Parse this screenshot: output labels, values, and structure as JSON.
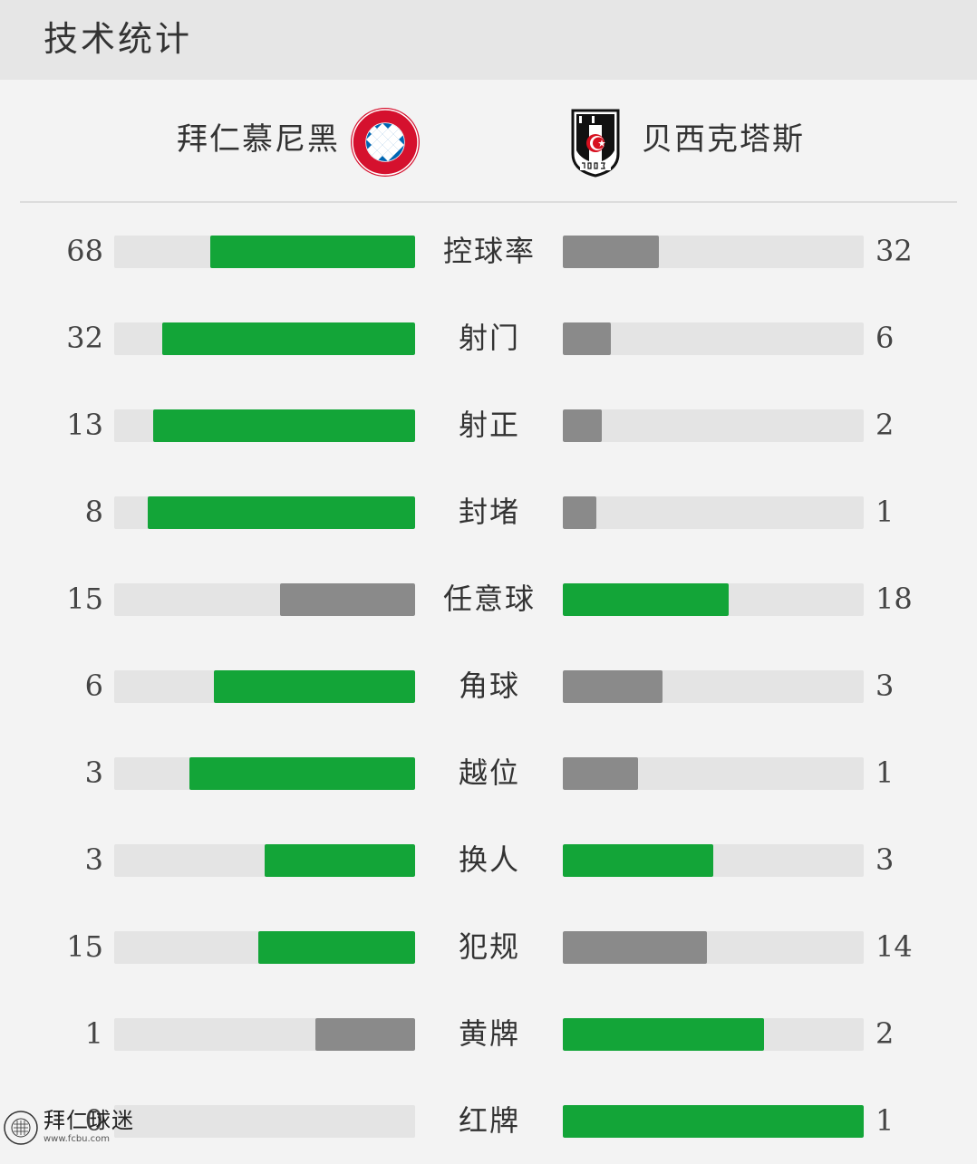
{
  "header": {
    "title": "技术统计"
  },
  "teams": {
    "home": {
      "name": "拜仁慕尼黑",
      "logo": "fc-bayern-logo-icon"
    },
    "away": {
      "name": "贝西克塔斯",
      "logo": "besiktas-logo-icon"
    }
  },
  "colors": {
    "leader": "#13a538",
    "trailer": "#8a8a8a",
    "track": "#e4e4e4"
  },
  "stats": [
    {
      "label": "控球率",
      "home": "68",
      "away": "32",
      "home_fill": 0.68,
      "away_fill": 0.32,
      "leader": "home"
    },
    {
      "label": "射门",
      "home": "32",
      "away": "6",
      "home_fill": 0.84,
      "away_fill": 0.16,
      "leader": "home"
    },
    {
      "label": "射正",
      "home": "13",
      "away": "2",
      "home_fill": 0.87,
      "away_fill": 0.13,
      "leader": "home"
    },
    {
      "label": "封堵",
      "home": "8",
      "away": "1",
      "home_fill": 0.89,
      "away_fill": 0.11,
      "leader": "home"
    },
    {
      "label": "任意球",
      "home": "15",
      "away": "18",
      "home_fill": 0.45,
      "away_fill": 0.55,
      "leader": "away"
    },
    {
      "label": "角球",
      "home": "6",
      "away": "3",
      "home_fill": 0.67,
      "away_fill": 0.33,
      "leader": "home"
    },
    {
      "label": "越位",
      "home": "3",
      "away": "1",
      "home_fill": 0.75,
      "away_fill": 0.25,
      "leader": "home"
    },
    {
      "label": "换人",
      "home": "3",
      "away": "3",
      "home_fill": 0.5,
      "away_fill": 0.5,
      "leader": "both"
    },
    {
      "label": "犯规",
      "home": "15",
      "away": "14",
      "home_fill": 0.52,
      "away_fill": 0.48,
      "leader": "home"
    },
    {
      "label": "黄牌",
      "home": "1",
      "away": "2",
      "home_fill": 0.33,
      "away_fill": 0.67,
      "leader": "away"
    },
    {
      "label": "红牌",
      "home": "0",
      "away": "1",
      "home_fill": 0.0,
      "away_fill": 1.0,
      "leader": "away"
    }
  ],
  "watermark": {
    "text": "拜仁球迷",
    "url": "www.fcbu.com"
  }
}
